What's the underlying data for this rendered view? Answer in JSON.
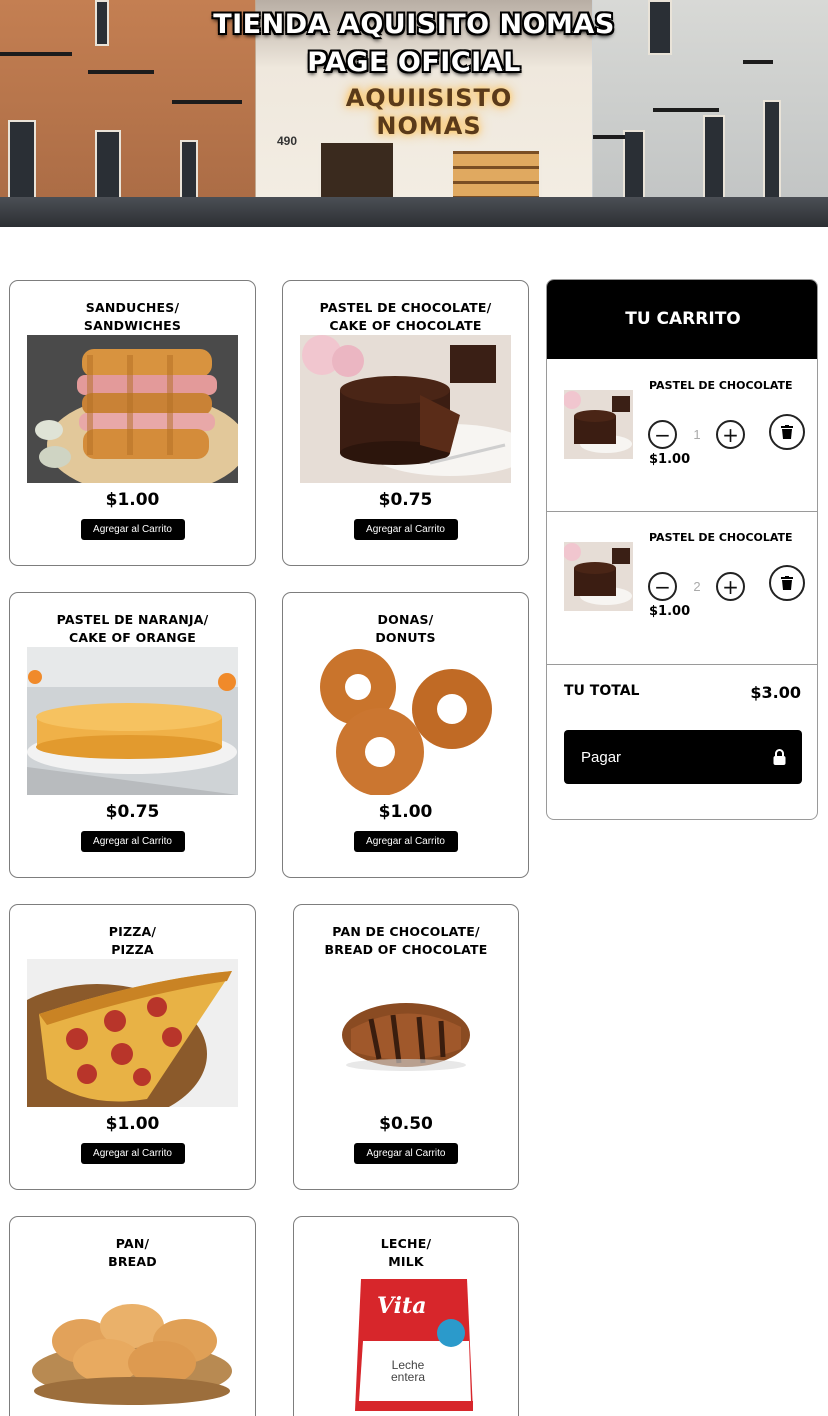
{
  "hero": {
    "title_line1": "TIENDA AQUISITO NOMAS",
    "title_line2": "PAGE OFICIAL",
    "shop_sign": "AQUIISISTO NOMAS",
    "shop_number": "490"
  },
  "products": [
    {
      "name_line1": "SANDUCHES/",
      "name_line2": "SANDWICHES",
      "price": "$1.00",
      "image": "sandwich-image"
    },
    {
      "name_line1": "PASTEL DE CHOCOLATE/",
      "name_line2": "CAKE OF CHOCOLATE",
      "price": "$0.75",
      "image": "chocolate-cake-image"
    },
    {
      "name_line1": "PASTEL DE NARANJA/",
      "name_line2": "CAKE OF ORANGE",
      "price": "$0.75",
      "image": "orange-cake-image"
    },
    {
      "name_line1": "DONAS/",
      "name_line2": "DONUTS",
      "price": "$1.00",
      "image": "donuts-image"
    },
    {
      "name_line1": "PIZZA/",
      "name_line2": "PIZZA",
      "price": "$1.00",
      "image": "pizza-image"
    },
    {
      "name_line1": "PAN DE CHOCOLATE/",
      "name_line2": "BREAD OF CHOCOLATE",
      "price": "$0.50",
      "image": "chocolate-bread-image"
    },
    {
      "name_line1": "PAN/",
      "name_line2": "BREAD",
      "price": "",
      "image": "bread-basket-image"
    },
    {
      "name_line1": "LECHE/",
      "name_line2": "MILK",
      "price": "",
      "image": "milk-bag-image"
    }
  ],
  "add_button_label": "Agregar al Carrito",
  "milk_brand": "Vita",
  "milk_label": "Leche entera",
  "cart": {
    "title": "TU CARRITO",
    "items": [
      {
        "name": "PASTEL DE CHOCOLATE",
        "qty": "1",
        "price": "$1.00"
      },
      {
        "name": "PASTEL DE CHOCOLATE",
        "qty": "2",
        "price": "$1.00"
      }
    ],
    "total_label": "TU TOTAL",
    "total_value": "$3.00",
    "pay_label": "Pagar"
  },
  "colors": {
    "button": "#000000",
    "card_border": "#7d7d7d",
    "cart_header": "#000000"
  }
}
